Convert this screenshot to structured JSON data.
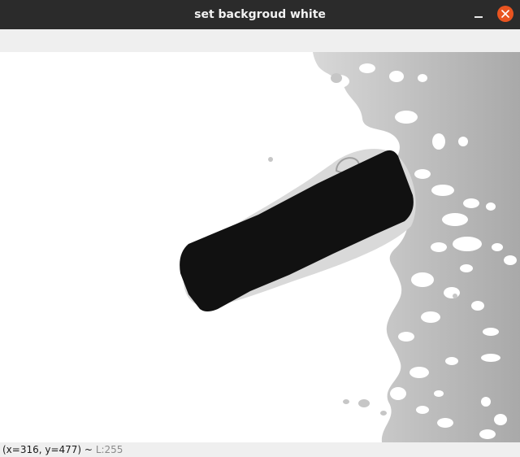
{
  "window": {
    "title": "set backgroud white"
  },
  "titlebar_buttons": {
    "minimize_icon": "minimize-icon",
    "close_icon": "close-icon",
    "close_color": "#e95420"
  },
  "image_view": {
    "description_icon": "depth-image",
    "background_color": "#ffffff",
    "object_color": "#111111"
  },
  "status": {
    "coords_text": "(x=316, y=477) ~",
    "level_text": "L:255"
  }
}
